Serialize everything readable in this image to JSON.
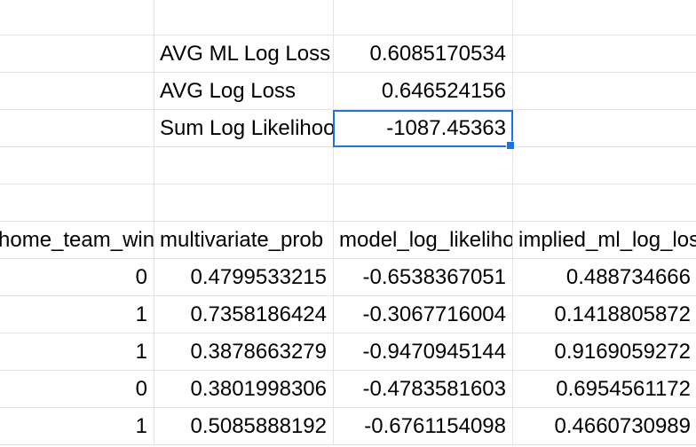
{
  "sheet": {
    "summary": [
      {
        "label": "AVG ML Log Loss",
        "value": "0.6085170534"
      },
      {
        "label": "AVG Log Loss",
        "value": "0.646524156"
      },
      {
        "label": "Sum Log Likelihood",
        "value": "-1087.45363"
      }
    ],
    "headers": [
      "home_team_win",
      "multivariate_prob",
      "model_log_likelihood",
      "implied_ml_log_loss"
    ],
    "rows": [
      [
        "0",
        "0.4799533215",
        "-0.6538367051",
        "0.488734666"
      ],
      [
        "1",
        "0.7358186424",
        "-0.3067716004",
        "0.1418805872"
      ],
      [
        "1",
        "0.3878663279",
        "-0.9470945144",
        "0.9169059272"
      ],
      [
        "0",
        "0.3801998306",
        "-0.4783581603",
        "0.6954561172"
      ],
      [
        "1",
        "0.5085888192",
        "-0.6761154098",
        "0.4660730989"
      ]
    ],
    "selection": {
      "cell": "sum-log-likelihood-value",
      "color": "#1a73e8"
    }
  }
}
